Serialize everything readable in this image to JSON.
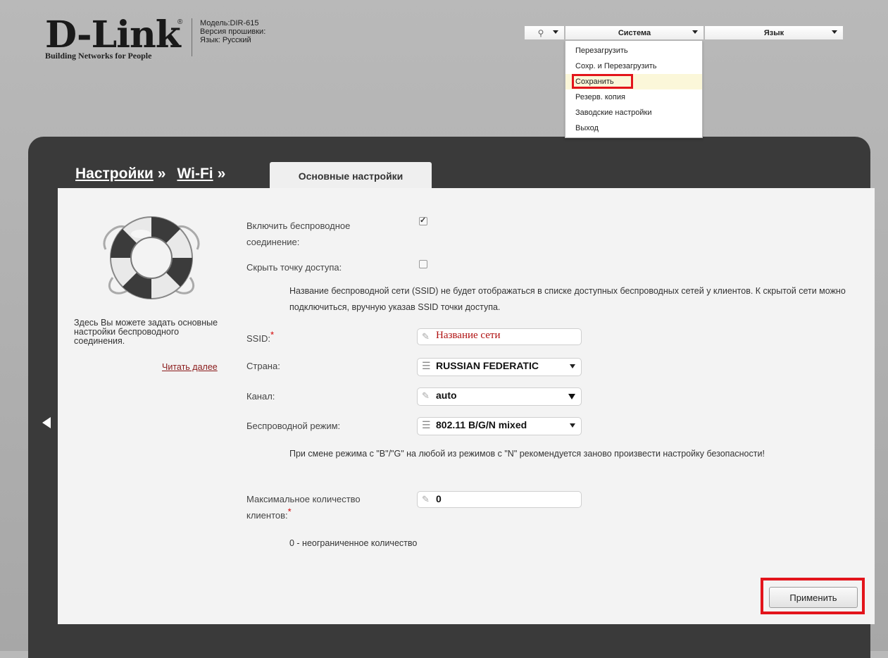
{
  "header": {
    "logo_text": "D-Link",
    "logo_reg": "®",
    "tagline": "Building Networks for People",
    "model_label": "Модель:",
    "model_value": "DIR-615",
    "firmware_label": "Версия прошивки:",
    "language_label": "Язык:",
    "language_value": "Русский"
  },
  "topbar": {
    "hint_icon": "lightbulb-icon",
    "system_label": "Система",
    "language_label": "Язык"
  },
  "system_menu": {
    "items": [
      "Перезагрузить",
      "Сохр. и Перезагрузить",
      "Сохранить",
      "Резерв. копия",
      "Заводские настройки",
      "Выход"
    ],
    "highlighted_index": 2
  },
  "breadcrumb": {
    "settings": "Настройки",
    "wifi": "Wi-Fi",
    "separator": "»"
  },
  "tab": {
    "label": "Основные настройки"
  },
  "sidebar": {
    "description": "Здесь Вы можете задать основные настройки беспроводного соединения.",
    "read_more": "Читать далее"
  },
  "form": {
    "enable_label": "Включить беспроводное соединение:",
    "enable_checked": true,
    "hide_label": "Скрыть точку доступа:",
    "hide_checked": false,
    "hide_note": "Название беспроводной сети (SSID) не будет отображаться в списке доступных беспроводных сетей у клиентов. К скрытой сети можно подключиться, вручную указав SSID точки доступа.",
    "ssid_label": "SSID:",
    "ssid_value": "Название сети",
    "country_label": "Страна:",
    "country_value": "RUSSIAN FEDERATIC",
    "channel_label": "Канал:",
    "channel_value": "auto",
    "mode_label": "Беспроводной режим:",
    "mode_value": "802.11 B/G/N mixed",
    "mode_note": "При смене режима с \"B\"/\"G\" на любой из режимов с \"N\" рекомендуется заново произвести настройку безопасности!",
    "max_clients_label": "Максимальное количество клиентов:",
    "max_clients_value": "0",
    "max_clients_note": "0 - неограниченное количество",
    "required_mark": "*"
  },
  "apply_button": "Применить",
  "colors": {
    "highlight_box": "#e3141b",
    "panel": "#3a3a3a",
    "content": "#f3f3f3"
  }
}
